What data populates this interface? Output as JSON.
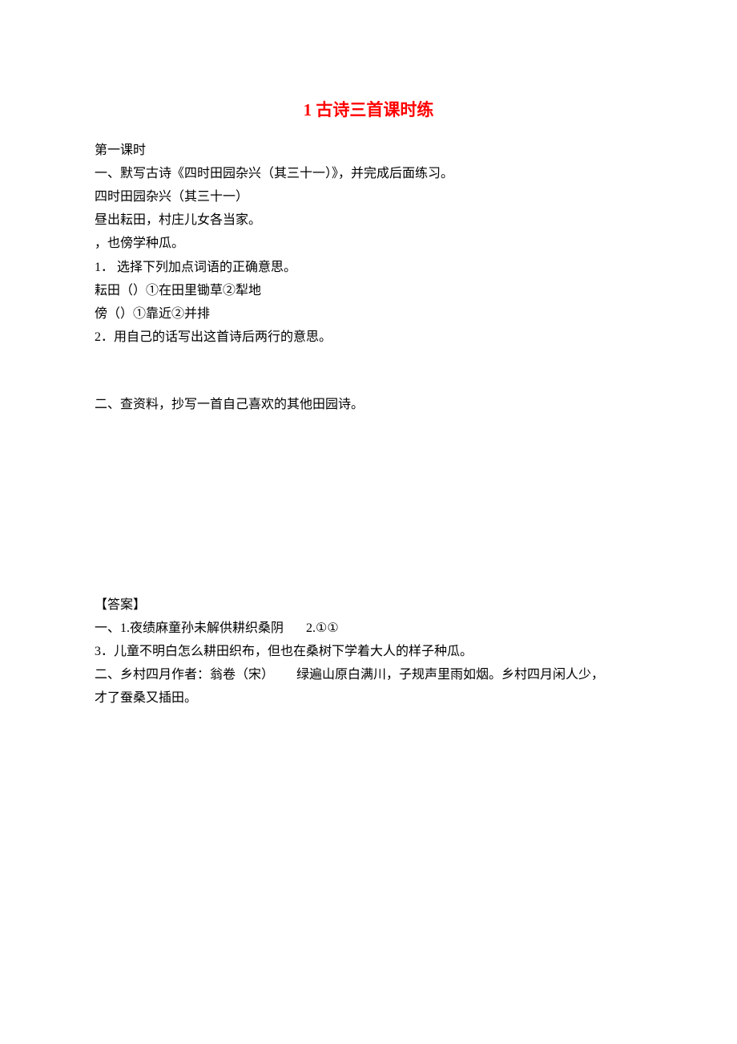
{
  "title": "1 古诗三首课时练",
  "lesson_header": "第一课时",
  "q1": {
    "heading": "一、默写古诗《四时田园杂兴（其三十一）》，并完成后面练习。",
    "poem_title": "四时田园杂兴（其三十一）",
    "poem_line1": "昼出耘田，村庄儿女各当家。",
    "poem_line2": "，也傍学种瓜。",
    "sub1": "1．  选择下列加点词语的正确意思。",
    "sub1_line1": "耘田（）①在田里锄草②犁地",
    "sub1_line2": "傍（）①靠近②并排",
    "sub2": "2．用自己的话写出这首诗后两行的意思。"
  },
  "q2": {
    "heading": "二、查资料，抄写一首自己喜欢的其他田园诗。"
  },
  "answers": {
    "header": "【答案】",
    "a1_line1_part1": "一、1.夜绩麻童孙未解供耕织桑阴",
    "a1_line1_part2": "2.①①",
    "a1_line2": "3．儿童不明白怎么耕田织布，但也在桑树下学着大人的样子种瓜。",
    "a2_part1": "二、乡村四月作者：翁卷（宋）",
    "a2_part2": "绿遍山原白满川，子规声里雨如烟。乡村四月闲人少，",
    "a2_line2": "才了蚕桑又插田。"
  }
}
